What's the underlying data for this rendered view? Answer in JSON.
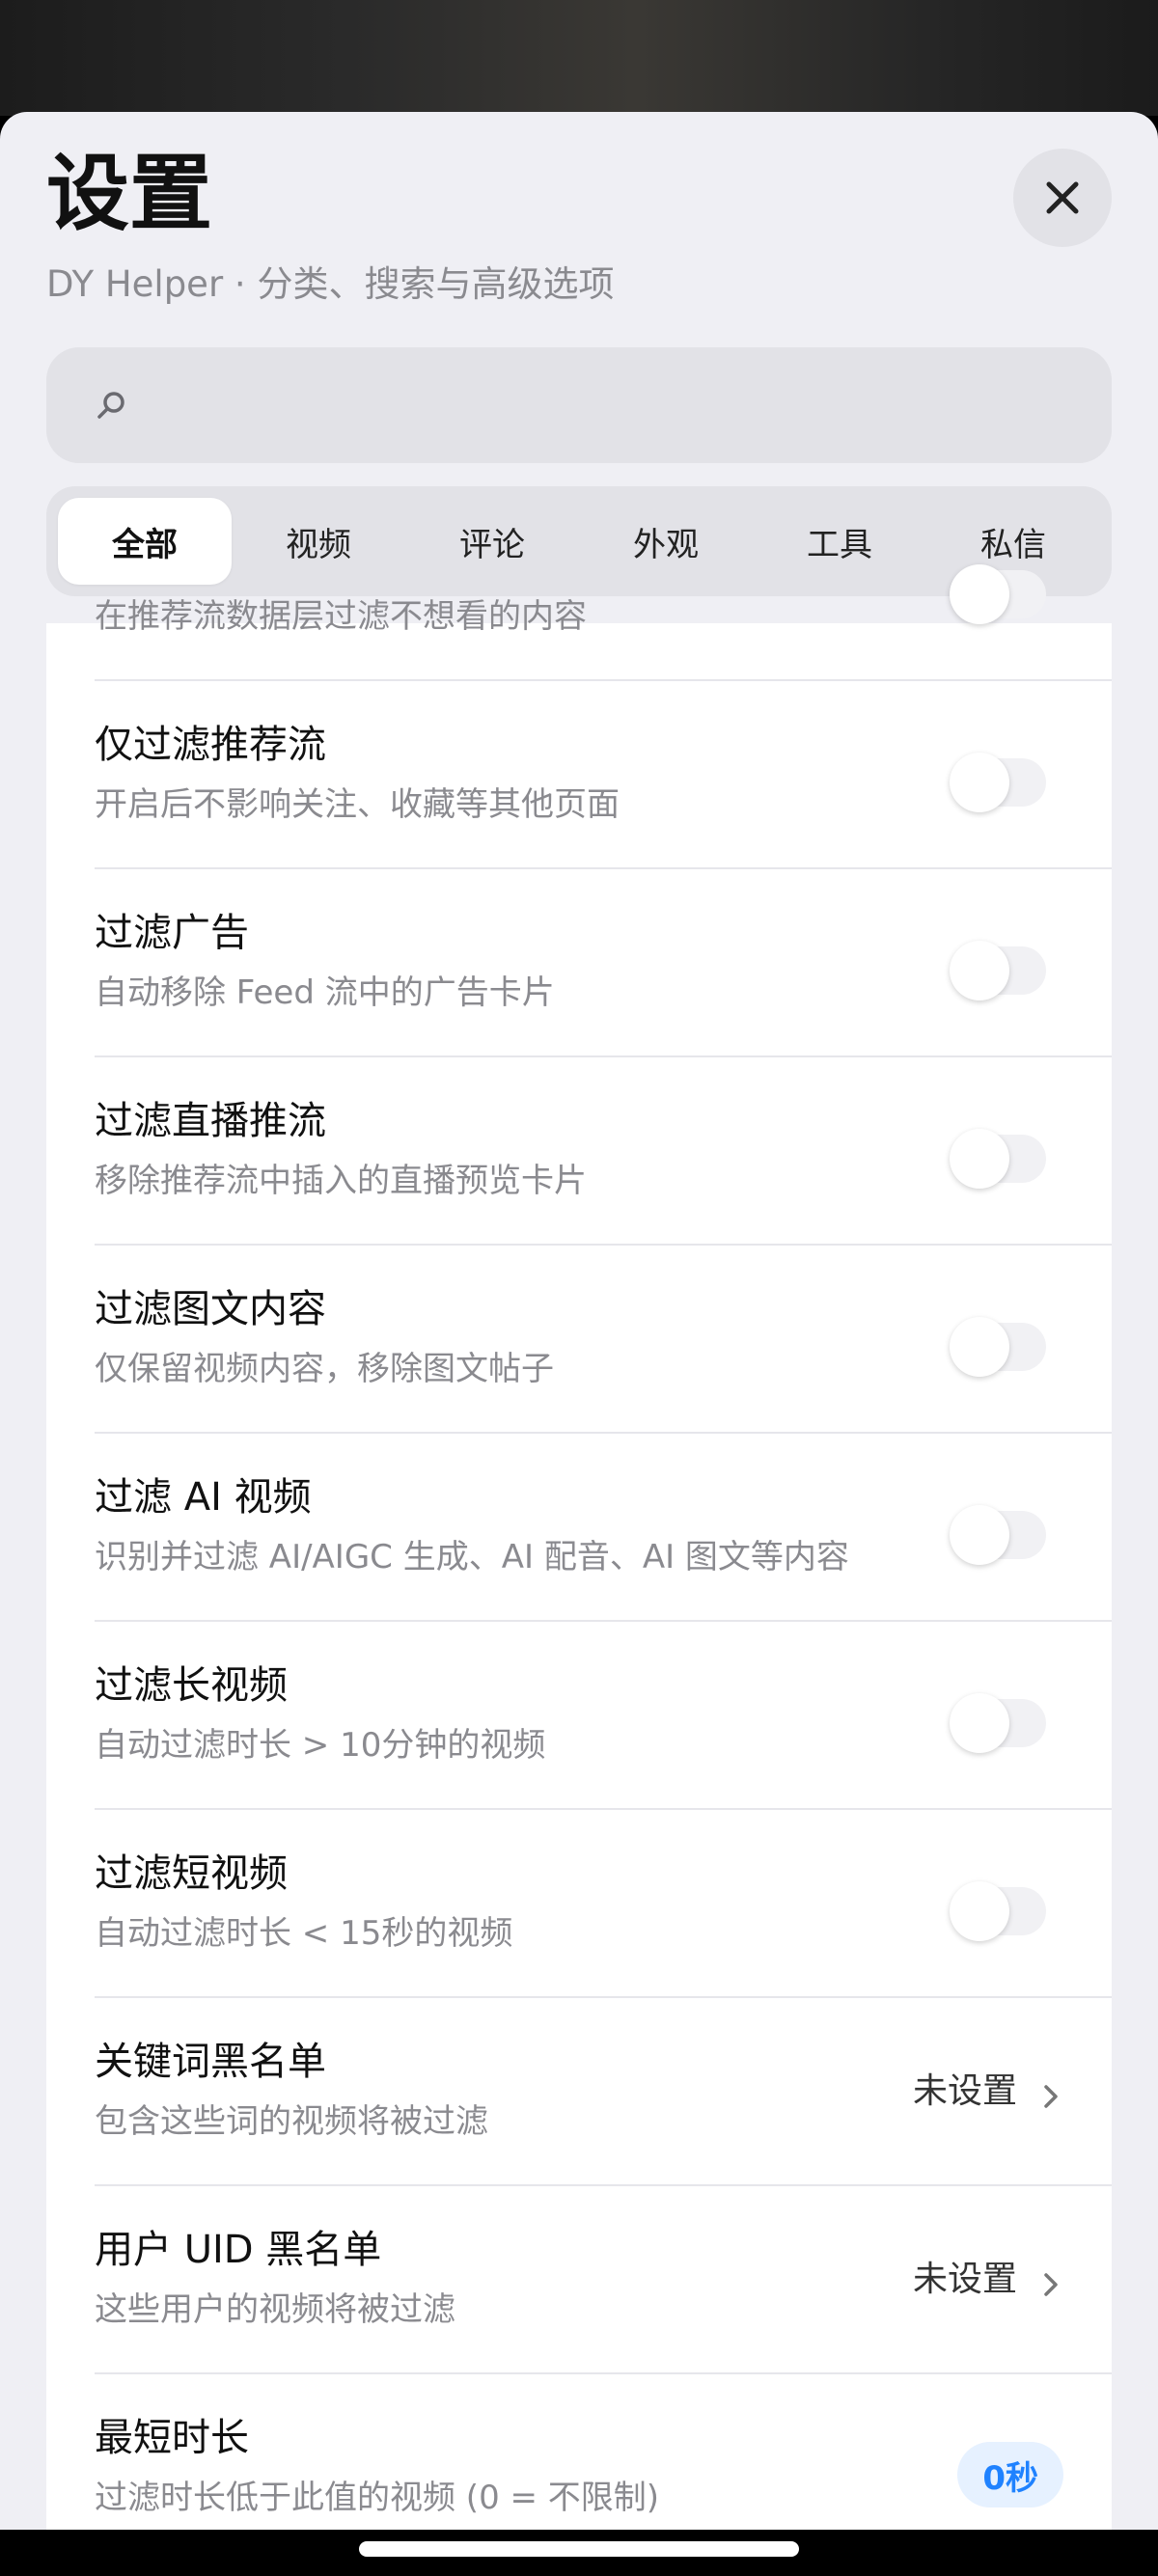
{
  "header": {
    "title": "设置",
    "subtitle": "DY Helper · 分类、搜索与高级选项"
  },
  "search": {
    "placeholder": "",
    "value": ""
  },
  "tabs": [
    {
      "label": "全部",
      "active": true
    },
    {
      "label": "视频",
      "active": false
    },
    {
      "label": "评论",
      "active": false
    },
    {
      "label": "外观",
      "active": false
    },
    {
      "label": "工具",
      "active": false
    },
    {
      "label": "私信",
      "active": false
    }
  ],
  "settings": [
    {
      "title": "",
      "desc": "在推荐流数据层过滤不想看的内容",
      "control": "toggle",
      "on": false
    },
    {
      "title": "仅过滤推荐流",
      "desc": "开启后不影响关注、收藏等其他页面",
      "control": "toggle",
      "on": false
    },
    {
      "title": "过滤广告",
      "desc": "自动移除 Feed 流中的广告卡片",
      "control": "toggle",
      "on": false
    },
    {
      "title": "过滤直播推流",
      "desc": "移除推荐流中插入的直播预览卡片",
      "control": "toggle",
      "on": false
    },
    {
      "title": "过滤图文内容",
      "desc": "仅保留视频内容，移除图文帖子",
      "control": "toggle",
      "on": false
    },
    {
      "title": "过滤 AI 视频",
      "desc": "识别并过滤 AI/AIGC 生成、AI 配音、AI 图文等内容",
      "control": "toggle",
      "on": false
    },
    {
      "title": "过滤长视频",
      "desc": "自动过滤时长 > 10分钟的视频",
      "control": "toggle",
      "on": false
    },
    {
      "title": "过滤短视频",
      "desc": "自动过滤时长 < 15秒的视频",
      "control": "toggle",
      "on": false
    },
    {
      "title": "关键词黑名单",
      "desc": "包含这些词的视频将被过滤",
      "control": "link",
      "value": "未设置"
    },
    {
      "title": "用户 UID 黑名单",
      "desc": "这些用户的视频将被过滤",
      "control": "link",
      "value": "未设置"
    },
    {
      "title": "最短时长",
      "desc": "过滤时长低于此值的视频 (0 = 不限制)",
      "control": "badge",
      "value": "0秒"
    }
  ],
  "colors": {
    "accent": "#1f82ff",
    "badge_bg": "#e6f1ff",
    "sheet_bg": "#efeff4"
  },
  "icons": {
    "close": "close-icon",
    "search": "search-icon",
    "chevron": "chevron-right-icon"
  }
}
